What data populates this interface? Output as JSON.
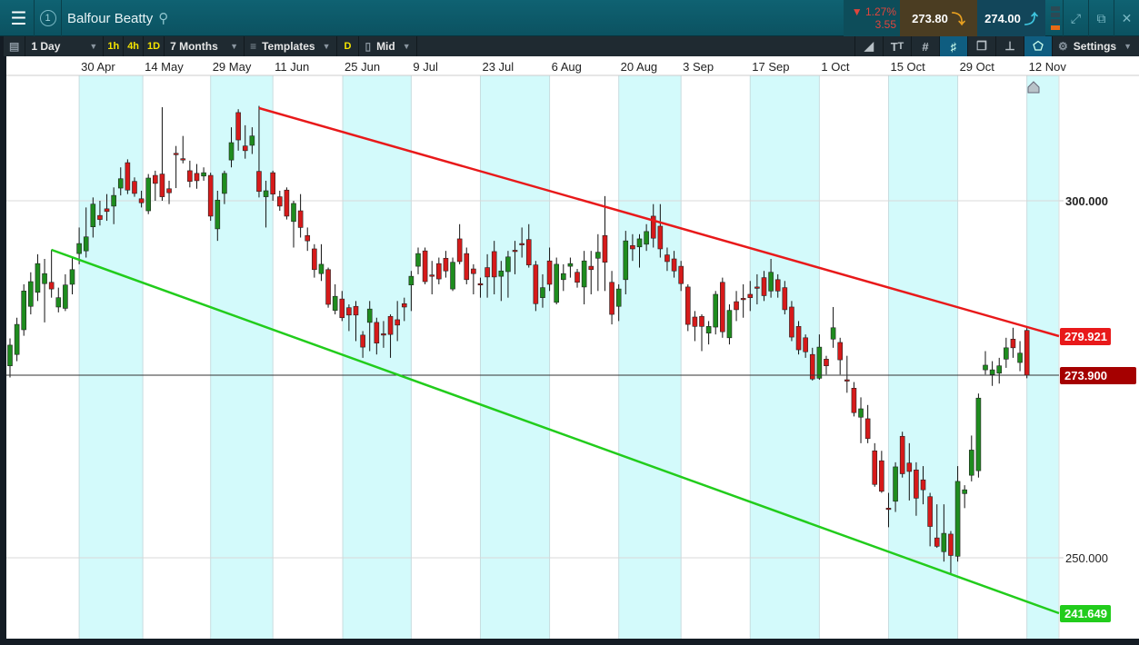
{
  "header": {
    "channel": "1",
    "title": "Balfour Beatty",
    "change_pct": "1.27%",
    "change_abs": "3.55",
    "sell_price": "273.80",
    "buy_price": "274.00"
  },
  "toolbar": {
    "interval": "1 Day",
    "quick": [
      "1h",
      "4h",
      "1D"
    ],
    "range": "7 Months",
    "templates": "Templates",
    "d_label": "D",
    "price_type": "Mid",
    "settings": "Settings"
  },
  "colors": {
    "up": "#1e8c1e",
    "down": "#d61a1a",
    "band": "#d3fafb",
    "resistance": "#e8191a",
    "support": "#22cc1c",
    "current": "#a50000"
  },
  "chart_data": {
    "type": "candlestick",
    "x_labels": [
      {
        "label": "30 Apr",
        "i": 10
      },
      {
        "label": "14 May",
        "i": 19.2
      },
      {
        "label": "29 May",
        "i": 29
      },
      {
        "label": "11 Jun",
        "i": 38
      },
      {
        "label": "25 Jun",
        "i": 48.1
      },
      {
        "label": "9 Jul",
        "i": 58
      },
      {
        "label": "23 Jul",
        "i": 68
      },
      {
        "label": "6 Aug",
        "i": 78
      },
      {
        "label": "20 Aug",
        "i": 88
      },
      {
        "label": "3 Sep",
        "i": 97
      },
      {
        "label": "17 Sep",
        "i": 107
      },
      {
        "label": "1 Oct",
        "i": 117
      },
      {
        "label": "15 Oct",
        "i": 127
      },
      {
        "label": "29 Oct",
        "i": 137
      },
      {
        "label": "12 Nov",
        "i": 147
      }
    ],
    "y_ticks": [
      "300.000",
      "250.000"
    ],
    "y_tick_values": [
      300,
      250
    ],
    "current_price": "273.900",
    "resistance": {
      "start_i": 36,
      "start_price": 313.9,
      "end_label": "279.921",
      "end_price": 279.921
    },
    "support": {
      "start_i": 6,
      "start_price": 292.7,
      "end_label": "241.649",
      "end_price": 241.649
    },
    "ohlc": [
      [
        275.3,
        279.4,
        273.6,
        278.4
      ],
      [
        277,
        282.5,
        276,
        281.5
      ],
      [
        280.7,
        287.5,
        279.8,
        286.5
      ],
      [
        284.2,
        289.3,
        283,
        287.9
      ],
      [
        286.3,
        292,
        285,
        290.6
      ],
      [
        287.6,
        291.3,
        281.8,
        289.1
      ],
      [
        287.8,
        292.7,
        285.5,
        286.8
      ],
      [
        284.1,
        287,
        283.3,
        285.5
      ],
      [
        283.9,
        289,
        283.5,
        287.4
      ],
      [
        287.5,
        291.5,
        286,
        289.7
      ],
      [
        292.1,
        296,
        290.5,
        293.6
      ],
      [
        292.5,
        299,
        291.5,
        294.6
      ],
      [
        296.1,
        300.5,
        294.5,
        299.5
      ],
      [
        297.8,
        300,
        296.3,
        297.2
      ],
      [
        298.8,
        301,
        297,
        298.4
      ],
      [
        299.2,
        302,
        296.5,
        300.8
      ],
      [
        301.9,
        305,
        300.8,
        303.3
      ],
      [
        305.7,
        306.2,
        301,
        301.6
      ],
      [
        302.9,
        303.5,
        300.6,
        301.1
      ],
      [
        300.3,
        301.5,
        299,
        299.7
      ],
      [
        298.5,
        304,
        298,
        303.4
      ],
      [
        303.8,
        304.5,
        300,
        302.6
      ],
      [
        304,
        314,
        300,
        300.6
      ],
      [
        301.8,
        303,
        299.5,
        301.2
      ],
      [
        307.1,
        308.2,
        301.9,
        307
      ],
      [
        306.3,
        309.7,
        305.6,
        306.1
      ],
      [
        304.5,
        306,
        302,
        302.9
      ],
      [
        304.1,
        305.5,
        301.8,
        303
      ],
      [
        303.7,
        305,
        303,
        304.2
      ],
      [
        303.8,
        304.2,
        297,
        297.7
      ],
      [
        295.8,
        301.5,
        294,
        300.1
      ],
      [
        301.1,
        304.5,
        299.5,
        304.1
      ],
      [
        306.1,
        311,
        305,
        308.7
      ],
      [
        313.2,
        313.7,
        307.5,
        309.1
      ],
      [
        308.2,
        311.3,
        306.3,
        307.5
      ],
      [
        308.3,
        311,
        307,
        309.7
      ],
      [
        304.4,
        314.2,
        300.5,
        301.4
      ],
      [
        300.6,
        303,
        296,
        301.5
      ],
      [
        304.2,
        304.5,
        300,
        301
      ],
      [
        300.6,
        301.5,
        298.5,
        299.2
      ],
      [
        301.6,
        302,
        297.2,
        297.7
      ],
      [
        296.9,
        300,
        293,
        299.6
      ],
      [
        298.5,
        301,
        294.5,
        296
      ],
      [
        294.8,
        296,
        292.5,
        294
      ],
      [
        292.8,
        293.5,
        288.5,
        289.7
      ],
      [
        289.1,
        293.5,
        288,
        290.5
      ],
      [
        289.7,
        290,
        284,
        284.5
      ],
      [
        283.6,
        287.5,
        283,
        285.7
      ],
      [
        285.3,
        286.5,
        282,
        282.5
      ],
      [
        284,
        284.5,
        280.5,
        282.9
      ],
      [
        284.2,
        285,
        279,
        282.9
      ],
      [
        279.9,
        280.5,
        276.5,
        278.1
      ],
      [
        281.8,
        285,
        277.5,
        283.8
      ],
      [
        281.8,
        282.5,
        277,
        278.7
      ],
      [
        280.1,
        282,
        278,
        280
      ],
      [
        282.7,
        283,
        276.5,
        280
      ],
      [
        282.2,
        285,
        279,
        281.4
      ],
      [
        284.6,
        285.5,
        282,
        284.1
      ],
      [
        287.4,
        289.5,
        283.5,
        288.7
      ],
      [
        290.2,
        293,
        289,
        292.1
      ],
      [
        292.5,
        293,
        287.5,
        287.9
      ],
      [
        288.9,
        291,
        286,
        288.8
      ],
      [
        290.6,
        291.5,
        287.5,
        288.3
      ],
      [
        291.4,
        292.5,
        288.5,
        289.5
      ],
      [
        286.8,
        291.5,
        286.5,
        290.8
      ],
      [
        294.3,
        296.5,
        290.5,
        290.9
      ],
      [
        292.1,
        293,
        287.5,
        288.2
      ],
      [
        289.8,
        290.5,
        286,
        289.1
      ],
      [
        287.6,
        288.5,
        285.5,
        287.5
      ],
      [
        290,
        292,
        285.5,
        288.6
      ],
      [
        292.4,
        294,
        286,
        288.6
      ],
      [
        288.7,
        291,
        285,
        289.5
      ],
      [
        289.4,
        292.5,
        285.5,
        291.6
      ],
      [
        292.6,
        294,
        289,
        292.5
      ],
      [
        293.6,
        296,
        291.5,
        293.5
      ],
      [
        294.2,
        296.5,
        290,
        290.4
      ],
      [
        290.4,
        291,
        283.5,
        284.6
      ],
      [
        285.5,
        289,
        284,
        287
      ],
      [
        291,
        293,
        286.5,
        287.5
      ],
      [
        284.8,
        291.5,
        284.5,
        290.5
      ],
      [
        288.2,
        290.5,
        286.5,
        289.1
      ],
      [
        290.2,
        291.5,
        288.5,
        290.6
      ],
      [
        289.3,
        289.8,
        287,
        287.8
      ],
      [
        287.1,
        292.5,
        284.5,
        291
      ],
      [
        290.2,
        292.5,
        286,
        289.7
      ],
      [
        291.4,
        295,
        286.5,
        292.3
      ],
      [
        294.8,
        300.7,
        286.5,
        290.8
      ],
      [
        287.8,
        289.5,
        281.5,
        283
      ],
      [
        284.2,
        287.5,
        282,
        286.8
      ],
      [
        288.2,
        295.5,
        286,
        294
      ],
      [
        293.3,
        295,
        291,
        292.8
      ],
      [
        293.1,
        295,
        290,
        294.3
      ],
      [
        293.5,
        296.5,
        292.5,
        295.4
      ],
      [
        297.7,
        299.5,
        293,
        294.4
      ],
      [
        296.2,
        299.5,
        291.5,
        292.8
      ],
      [
        291.9,
        293,
        289.5,
        290.9
      ],
      [
        291.3,
        292.5,
        288.5,
        289.5
      ],
      [
        290.2,
        291,
        286.5,
        287.6
      ],
      [
        287.1,
        287.5,
        280.5,
        281.5
      ],
      [
        282.6,
        283.5,
        279,
        281.2
      ],
      [
        282.7,
        283,
        277.5,
        281.2
      ],
      [
        280.2,
        282,
        278.5,
        281.2
      ],
      [
        281.1,
        286.5,
        280,
        286
      ],
      [
        287.8,
        288.5,
        279.5,
        280.4
      ],
      [
        279.5,
        284.5,
        278.5,
        283.6
      ],
      [
        284.9,
        286.5,
        282,
        283.7
      ],
      [
        285.4,
        287.5,
        282.5,
        285.3
      ],
      [
        286,
        288,
        283.5,
        285.5
      ],
      [
        287.1,
        289,
        284.5,
        287
      ],
      [
        288.5,
        289.5,
        285,
        285.8
      ],
      [
        286.5,
        291.3,
        285.5,
        289.3
      ],
      [
        288.2,
        289,
        285.5,
        286.5
      ],
      [
        287,
        288,
        283,
        283.7
      ],
      [
        284.1,
        285,
        279,
        279.6
      ],
      [
        281.2,
        282,
        277,
        277.7
      ],
      [
        279.5,
        280,
        276.5,
        277.4
      ],
      [
        277,
        278,
        273.2,
        273.4
      ],
      [
        273.5,
        280,
        273.3,
        278.1
      ],
      [
        276.3,
        276.8,
        274,
        275.3
      ],
      [
        279.3,
        284.1,
        278,
        281
      ],
      [
        278.8,
        279.5,
        274,
        276.2
      ],
      [
        273.3,
        276.8,
        271.6,
        273.2
      ],
      [
        272.2,
        273,
        268.5,
        269
      ],
      [
        268.4,
        271,
        265,
        269.5
      ],
      [
        268.2,
        270,
        265,
        265.6
      ],
      [
        264,
        265,
        259.3,
        259.6
      ],
      [
        262.7,
        264,
        258.5,
        258.7
      ],
      [
        256.5,
        258.5,
        254,
        256.4
      ],
      [
        257.4,
        262.5,
        256,
        261.9
      ],
      [
        265.9,
        266.5,
        260.5,
        261
      ],
      [
        262.4,
        265,
        257.5,
        261.3
      ],
      [
        261.5,
        262.5,
        255.5,
        257.8
      ],
      [
        260.2,
        262,
        257,
        258.9
      ],
      [
        258,
        258.5,
        251.5,
        254.1
      ],
      [
        252.6,
        257,
        251.3,
        251.5
      ],
      [
        250.8,
        257,
        249.5,
        253.2
      ],
      [
        253.1,
        253.5,
        247.8,
        250.3
      ],
      [
        250.2,
        262,
        249.5,
        260
      ],
      [
        258.4,
        259.5,
        256.5,
        258.9
      ],
      [
        260.8,
        266,
        260,
        264.1
      ],
      [
        261.4,
        271.5,
        260.5,
        270.9
      ],
      [
        274.7,
        277.5,
        274,
        275.4
      ],
      [
        274,
        276,
        272.5,
        274.7
      ],
      [
        274.2,
        276.5,
        272.8,
        275.3
      ],
      [
        276.3,
        279.5,
        275,
        278
      ],
      [
        279.3,
        281,
        276.5,
        278
      ],
      [
        275.8,
        279,
        274.5,
        277.2
      ],
      [
        280.6,
        281,
        273.5,
        273.9
      ]
    ]
  }
}
